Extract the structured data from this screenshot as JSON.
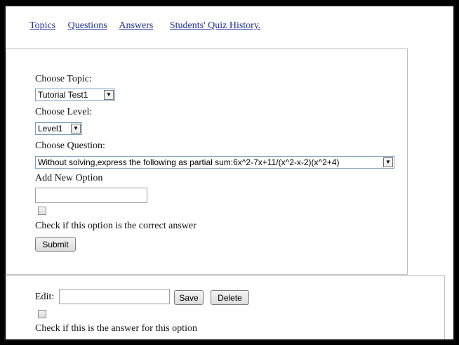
{
  "nav": {
    "topics": "Topics",
    "questions": "Questions",
    "answers": "Answers",
    "history": "Students' Quiz History."
  },
  "form": {
    "choose_topic_label": "Choose Topic:",
    "topic_selected": "Tutorial Test1",
    "choose_level_label": "Choose Level:",
    "level_selected": "Level1",
    "choose_question_label": "Choose Question:",
    "question_selected": "Without solving,express the following as partial sum:6x^2-7x+11/(x^2-x-2)(x^2+4)",
    "add_option_label": "Add New Option",
    "new_option_value": "",
    "correct_checkbox_label": "Check if this option is the correct answer",
    "submit_label": "Submit"
  },
  "edit": {
    "edit_label": "Edit:",
    "edit_value": "",
    "save_label": "Save",
    "delete_label": "Delete",
    "answer_checkbox_label": "Check if this is the answer for this option"
  },
  "colors": {
    "link": "#1f2f9a",
    "border": "#bfbfbf",
    "background": "#ffffff",
    "outer": "#000000"
  }
}
